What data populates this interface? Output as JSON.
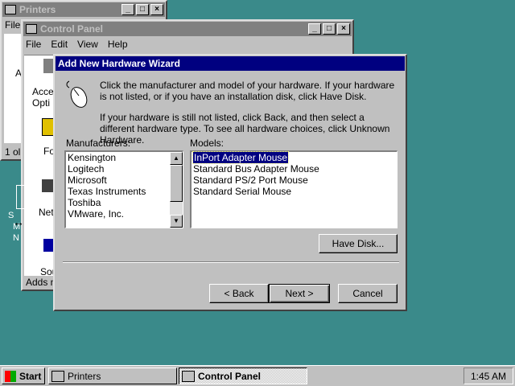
{
  "desktop": {
    "printers_window": {
      "title": "Printers",
      "menu_first": "File",
      "side_text_a": "A",
      "status": "1 ol"
    },
    "control_panel": {
      "title": "Control Panel",
      "menu": [
        "File",
        "Edit",
        "View",
        "Help"
      ],
      "items": [
        {
          "label": "Access Opti"
        },
        {
          "label": "Fo"
        },
        {
          "label": "Netw"
        },
        {
          "label": "Sou"
        }
      ],
      "status": "Adds ne"
    },
    "desktop_icon_label": [
      "S",
      "M",
      "N"
    ]
  },
  "wizard": {
    "title": "Add New Hardware Wizard",
    "instruction1": "Click the manufacturer and model of your hardware. If your hardware is not listed, or if you have an installation disk, click Have Disk.",
    "instruction2": "If your hardware is still not listed, click Back, and then select a different hardware type. To see all hardware choices, click Unknown Hardware.",
    "manufacturers_label": "Manufacturers:",
    "models_label": "Models:",
    "manufacturers": [
      "Kensington",
      "Logitech",
      "Microsoft",
      "Texas Instruments",
      "Toshiba",
      "VMware, Inc."
    ],
    "models": [
      "InPort Adapter Mouse",
      "Standard Bus Adapter Mouse",
      "Standard PS/2 Port Mouse",
      "Standard Serial Mouse"
    ],
    "selected_model": "InPort Adapter Mouse",
    "have_disk_label": "Have Disk...",
    "back_label": "< Back",
    "next_label": "Next >",
    "cancel_label": "Cancel"
  },
  "taskbar": {
    "start_label": "Start",
    "items": [
      {
        "label": "Printers"
      },
      {
        "label": "Control Panel"
      }
    ],
    "clock": "1:45 AM"
  },
  "colors": {
    "desktop": "#3a8a8a",
    "active_title": "#000080",
    "inactive_title": "#808080",
    "face": "#c0c0c0"
  }
}
